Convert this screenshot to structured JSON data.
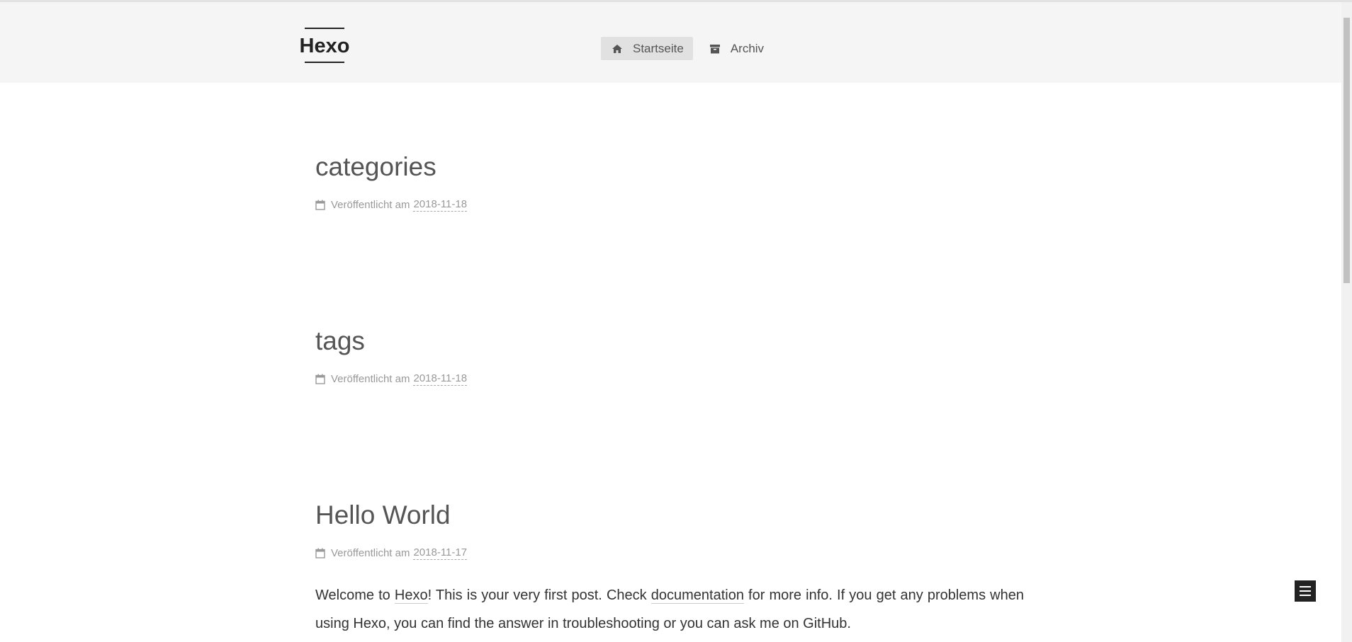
{
  "site": {
    "logo": "Hexo"
  },
  "nav": {
    "items": [
      {
        "label": "Startseite",
        "icon": "home-icon",
        "active": true
      },
      {
        "label": "Archiv",
        "icon": "archive-icon",
        "active": false
      }
    ]
  },
  "posts": [
    {
      "title": "categories",
      "meta_label": "Veröffentlicht am",
      "date": "2018-11-18"
    },
    {
      "title": "tags",
      "meta_label": "Veröffentlicht am",
      "date": "2018-11-18"
    },
    {
      "title": "Hello World",
      "meta_label": "Veröffentlicht am",
      "date": "2018-11-17",
      "body": {
        "p1_a": "Welcome to ",
        "link_hexo": "Hexo",
        "p1_b": "! This is your very first post. Check ",
        "link_docs": "documentation",
        "p1_c": " for more info. If you get any problems when using Hexo, you can find the answer in troubleshooting or you can ask me on GitHub."
      }
    }
  ],
  "colors": {
    "header_bg": "#f5f5f5",
    "active_nav_bg": "#e1e1e1",
    "text": "#555555",
    "meta": "#999999"
  }
}
